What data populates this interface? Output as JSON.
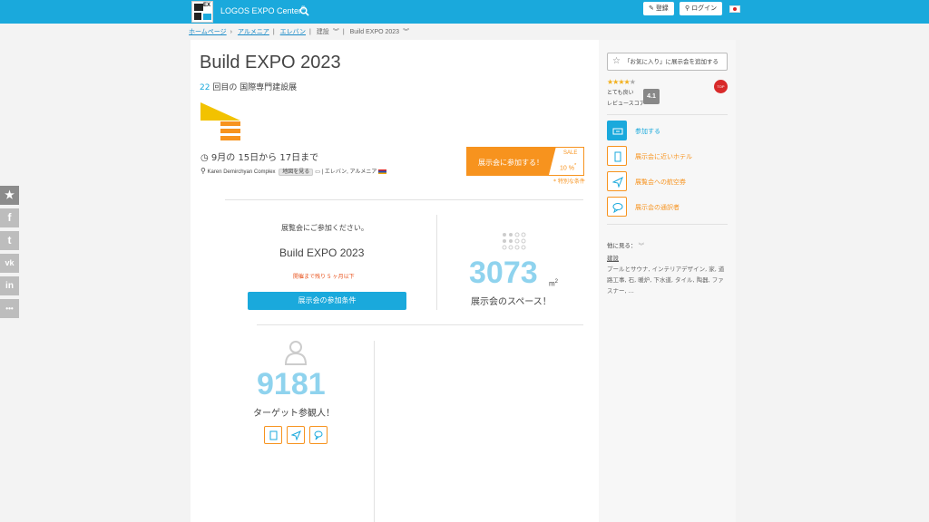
{
  "topbar": {
    "logo_text": "EX",
    "brand": "LOGOS EXPO Center",
    "brand_mark": "©",
    "register_label": "登録",
    "login_label": "ログイン"
  },
  "breadcrumb": [
    "ホームページ",
    "アルメニア",
    "エレバン",
    "建設",
    "Build EXPO 2023"
  ],
  "event": {
    "title": "Build EXPO 2023",
    "edition_num": "22",
    "edition_text": " 回目の 国際専門建設展",
    "dates": "9月の 15日から 17日まで",
    "venue": "Karen Demirchyan Complex",
    "map_label": "地図を見る",
    "location": "エレバン, アルメニア",
    "cta_label": "展示会に参加する！",
    "sale_label": "SALE",
    "sale_value": "10 %",
    "sale_mark": "*",
    "special_conditions": "* 特別な条件"
  },
  "invite": {
    "text": "展覧会にご参加ください。",
    "name": "Build EXPO 2023",
    "countdown": "開催まで残り 5 ヶ月以下",
    "button": "展示会の参加条件"
  },
  "space": {
    "value": "3073",
    "unit": "m",
    "unit_sup": "2",
    "label": "展示会のスペース！"
  },
  "visitors": {
    "value": "9181",
    "label": "ターゲット参観人！"
  },
  "sidebar": {
    "favorite_label": "「お気に入り」に展示会を追加する",
    "rating_stars": 4,
    "rating_text": "とても良い",
    "review_label": "レビュースコア",
    "score": "4.1",
    "top_badge": "TOP",
    "actions": [
      {
        "label": "参加する"
      },
      {
        "label": "展示会に近いホテル"
      },
      {
        "label": "展覧会への航空券"
      },
      {
        "label": "展示会の通訳者"
      }
    ],
    "see_more": "他に見る：",
    "category": "建設",
    "tags": "プールとサウナ, インテリアデザイン, 家, 道路工事, 石, 暖炉, 下水道, タイル, 陶器, ファスナー, ..."
  },
  "social": [
    "★",
    "f",
    "t",
    "vk",
    "in",
    "•••"
  ],
  "colors": {
    "primary": "#1aa9dc",
    "accent": "#f7931e",
    "stat": "#8fd3ee"
  }
}
